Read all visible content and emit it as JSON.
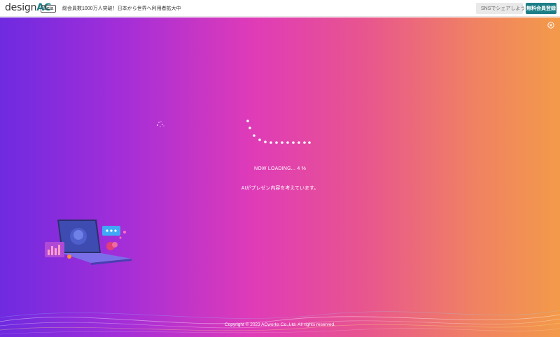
{
  "header": {
    "logo_text": "design",
    "logo_accent": "AC",
    "beta_label": "Beta",
    "tagline": "総会員数1000万人突破！日本から世界へ利用者拡大中",
    "share_button_label": "SNSでシェアしよう!",
    "signup_button_label": "無料会員登録"
  },
  "loading": {
    "progress_text": "NOW LOADING... 4 %",
    "progress_percent": 4,
    "status_message": "AIがプレゼン内容を考えています。"
  },
  "footer": {
    "copyright": "Copyright © 2023 ACworks Co.,Ltd. All rights reserved."
  },
  "icons": {
    "share": "share-icon",
    "close": "close-circle-icon",
    "spinner": "loading-spinner-icon"
  },
  "colors": {
    "brand_teal": "#1c7f87",
    "gradient_start": "#6f2ae0",
    "gradient_mid": "#df3bb8",
    "gradient_end": "#f39a4a"
  }
}
